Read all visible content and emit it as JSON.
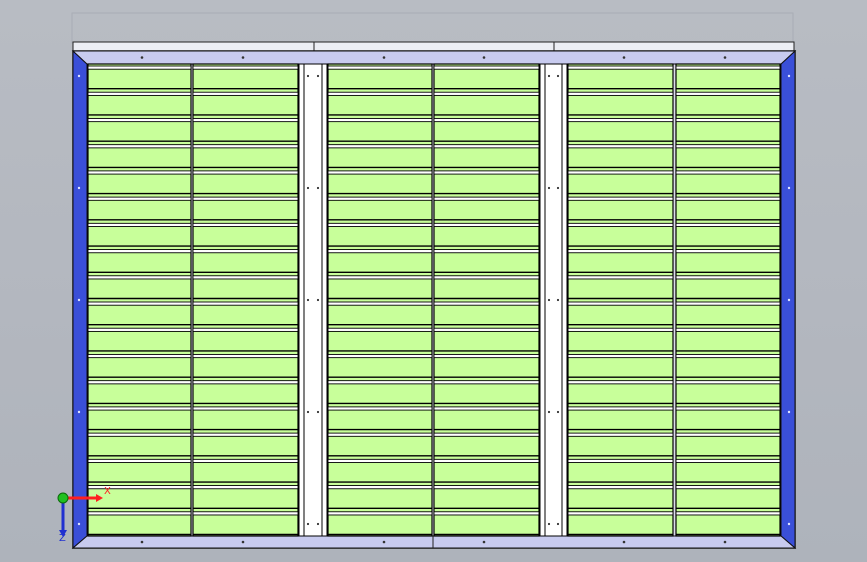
{
  "viewport": {
    "background_color": "#b3b7bf"
  },
  "model": {
    "frame_color": "#e6e6f0",
    "frame_border_color": "#c4c6e2",
    "side_panel_color": "#3a4fd8",
    "cell_color": "#c8ff9a",
    "slat_color": "#ffffff",
    "edge_color": "#000000",
    "channel_color": "#ffffff",
    "slat_rows": 18,
    "columns_per_bay": 2,
    "bays": 3
  },
  "triad": {
    "x_label": "X",
    "z_label": "Z",
    "x_color": "#ff2020",
    "y_color": "#20c020",
    "z_color": "#2030d0"
  }
}
